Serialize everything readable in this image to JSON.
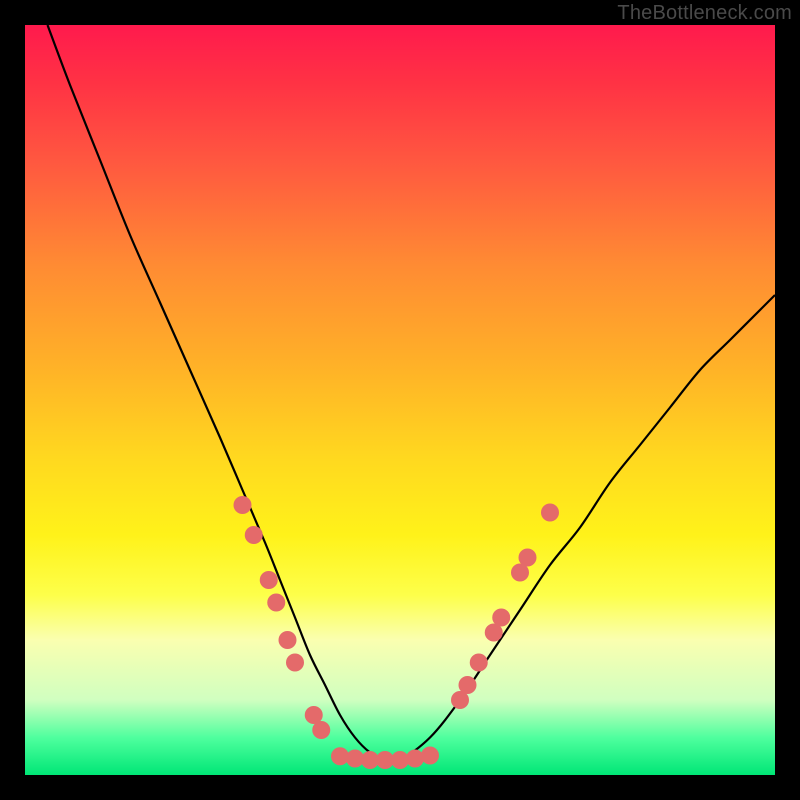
{
  "watermark": "TheBottleneck.com",
  "chart_data": {
    "type": "line",
    "title": "",
    "xlabel": "",
    "ylabel": "",
    "xlim": [
      0,
      100
    ],
    "ylim": [
      0,
      100
    ],
    "grid": false,
    "legend": false,
    "series": [
      {
        "name": "bottleneck-curve",
        "color": "#000000",
        "x": [
          3,
          6,
          10,
          14,
          18,
          22,
          26,
          29,
          32,
          34,
          36,
          38,
          40,
          42,
          44,
          46,
          48,
          50,
          54,
          58,
          62,
          66,
          70,
          74,
          78,
          82,
          86,
          90,
          94,
          98,
          100
        ],
        "y": [
          100,
          92,
          82,
          72,
          63,
          54,
          45,
          38,
          31,
          26,
          21,
          16,
          12,
          8,
          5,
          3,
          2,
          2,
          5,
          10,
          16,
          22,
          28,
          33,
          39,
          44,
          49,
          54,
          58,
          62,
          64
        ]
      }
    ],
    "markers": [
      {
        "name": "left-cluster",
        "color": "#e46a6a",
        "points": [
          {
            "x": 29.0,
            "y": 36
          },
          {
            "x": 30.5,
            "y": 32
          },
          {
            "x": 32.5,
            "y": 26
          },
          {
            "x": 33.5,
            "y": 23
          },
          {
            "x": 35.0,
            "y": 18
          },
          {
            "x": 36.0,
            "y": 15
          },
          {
            "x": 38.5,
            "y": 8
          },
          {
            "x": 39.5,
            "y": 6
          }
        ]
      },
      {
        "name": "valley-cluster",
        "color": "#e46a6a",
        "points": [
          {
            "x": 42,
            "y": 2.5
          },
          {
            "x": 44,
            "y": 2.2
          },
          {
            "x": 46,
            "y": 2.0
          },
          {
            "x": 48,
            "y": 2.0
          },
          {
            "x": 50,
            "y": 2.0
          },
          {
            "x": 52,
            "y": 2.2
          },
          {
            "x": 54,
            "y": 2.6
          }
        ]
      },
      {
        "name": "right-cluster",
        "color": "#e46a6a",
        "points": [
          {
            "x": 58.0,
            "y": 10
          },
          {
            "x": 59.0,
            "y": 12
          },
          {
            "x": 60.5,
            "y": 15
          },
          {
            "x": 62.5,
            "y": 19
          },
          {
            "x": 63.5,
            "y": 21
          },
          {
            "x": 66.0,
            "y": 27
          },
          {
            "x": 67.0,
            "y": 29
          },
          {
            "x": 70.0,
            "y": 35
          }
        ]
      }
    ],
    "background_gradient": {
      "top": "#ff1a4d",
      "mid": "#ffd91f",
      "bottom": "#00e676"
    }
  }
}
